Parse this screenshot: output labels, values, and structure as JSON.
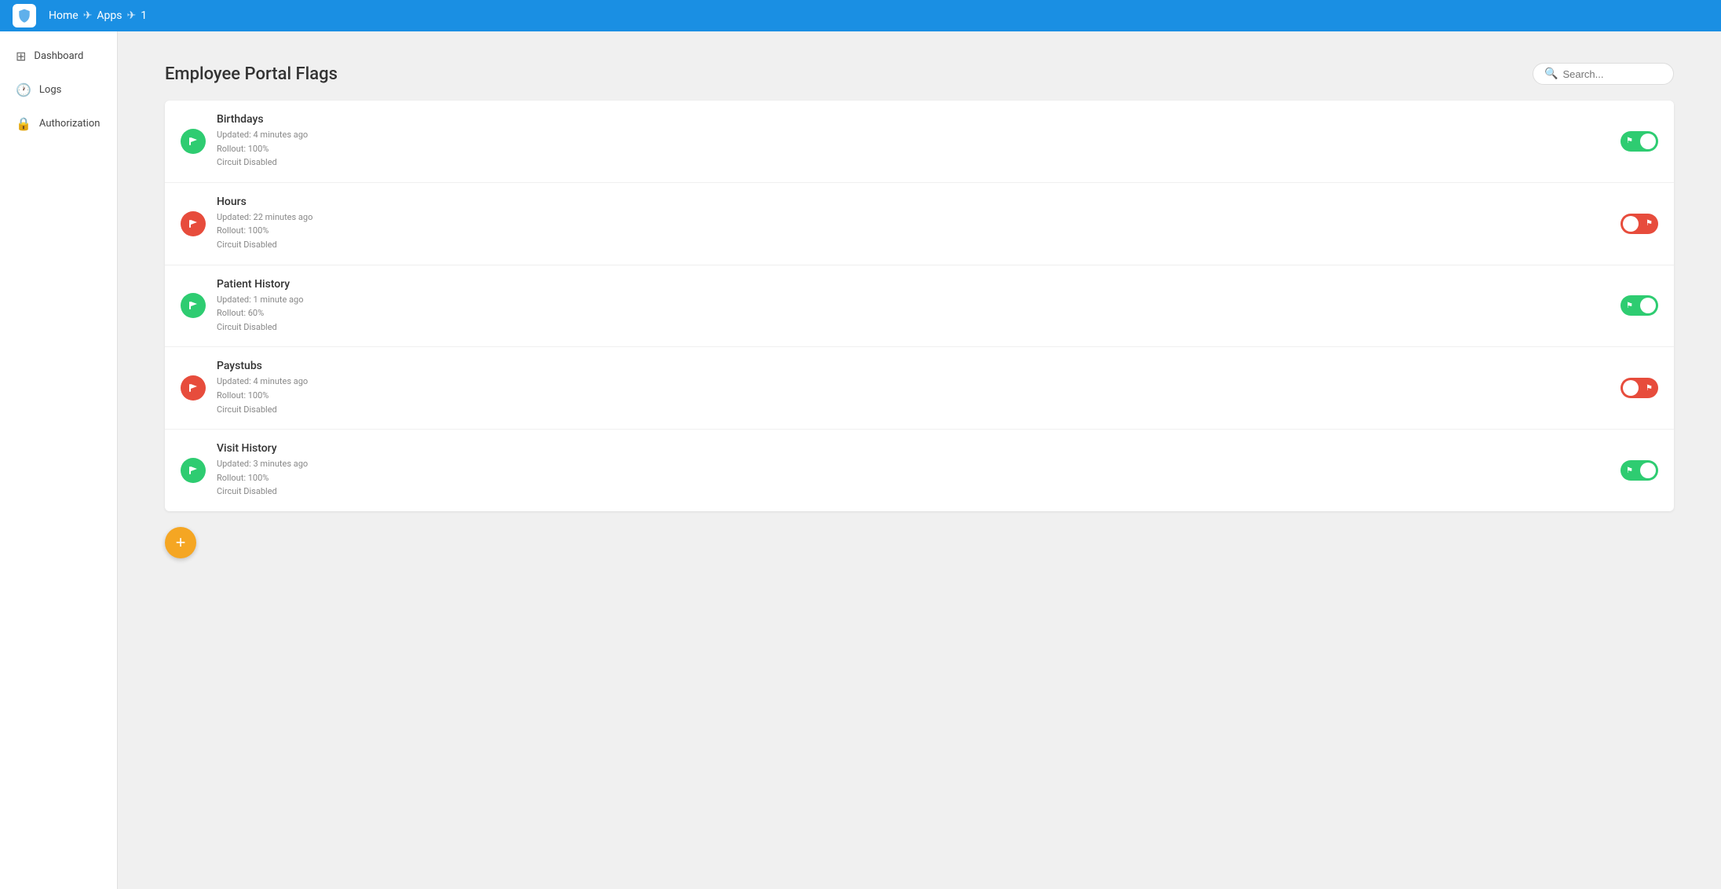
{
  "topNav": {
    "logoAlt": "Shield Logo",
    "breadcrumbs": [
      "Home",
      "Apps",
      "1"
    ]
  },
  "sidebar": {
    "items": [
      {
        "id": "dashboard",
        "label": "Dashboard",
        "icon": "⊞"
      },
      {
        "id": "logs",
        "label": "Logs",
        "icon": "🕐"
      },
      {
        "id": "authorization",
        "label": "Authorization",
        "icon": "🔒"
      }
    ]
  },
  "main": {
    "title": "Employee Portal Flags",
    "search": {
      "placeholder": "Search..."
    },
    "flags": [
      {
        "id": "birthdays",
        "name": "Birthdays",
        "iconColor": "green",
        "updatedAgo": "Updated: 4 minutes ago",
        "rollout": "Rollout: 100%",
        "circuit": "Circuit Disabled",
        "enabled": true
      },
      {
        "id": "hours",
        "name": "Hours",
        "iconColor": "red",
        "updatedAgo": "Updated: 22 minutes ago",
        "rollout": "Rollout: 100%",
        "circuit": "Circuit Disabled",
        "enabled": false
      },
      {
        "id": "patient-history",
        "name": "Patient History",
        "iconColor": "green",
        "updatedAgo": "Updated: 1 minute ago",
        "rollout": "Rollout: 60%",
        "circuit": "Circuit Disabled",
        "enabled": true
      },
      {
        "id": "paystubs",
        "name": "Paystubs",
        "iconColor": "red",
        "updatedAgo": "Updated: 4 minutes ago",
        "rollout": "Rollout: 100%",
        "circuit": "Circuit Disabled",
        "enabled": false
      },
      {
        "id": "visit-history",
        "name": "Visit History",
        "iconColor": "green",
        "updatedAgo": "Updated: 3 minutes ago",
        "rollout": "Rollout: 100%",
        "circuit": "Circuit Disabled",
        "enabled": true
      }
    ],
    "addButtonLabel": "+"
  }
}
